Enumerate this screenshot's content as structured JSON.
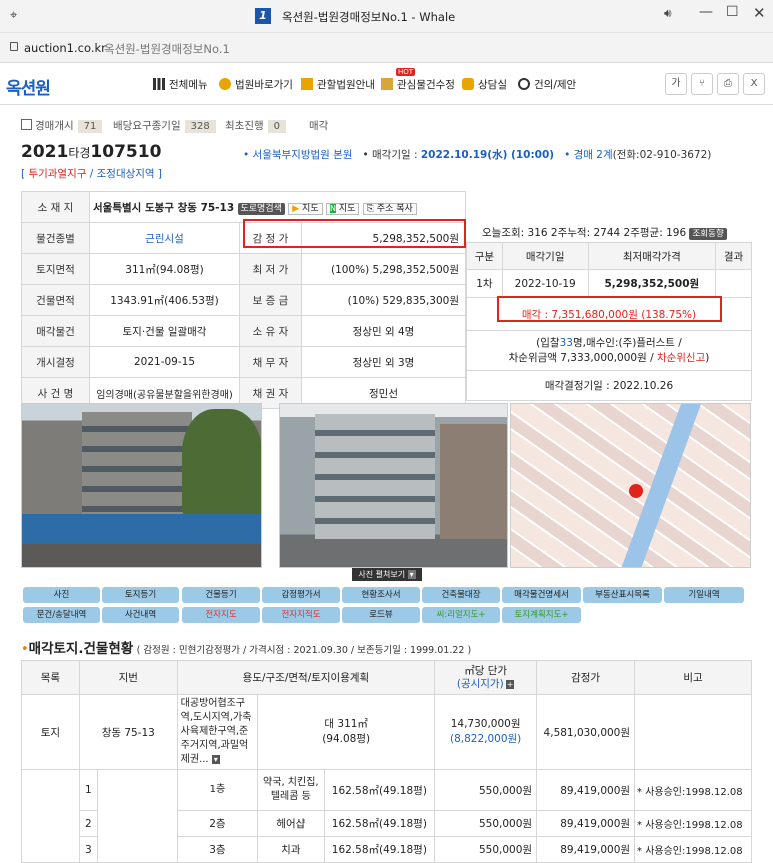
{
  "window": {
    "title": "옥션원-법원경매정보No.1 - Whale"
  },
  "address": {
    "url": "auction1.co.kr",
    "page_title": "옥션원-법원경매정보No.1"
  },
  "nav": {
    "logo": "옥션원",
    "items": [
      "전체메뉴",
      "법원바로가기",
      "관할법원안내",
      "관심물건수정",
      "상담실",
      "건의/제안"
    ],
    "hot_badge": "HOT",
    "right_buttons": [
      "가",
      "share",
      "print",
      "X"
    ]
  },
  "steps": [
    {
      "label": "경매개시",
      "count": "71"
    },
    {
      "label": "배당요구종기일",
      "count": "328"
    },
    {
      "label": "최초진행",
      "count": "0"
    },
    {
      "label": "매각",
      "count": ""
    }
  ],
  "case": {
    "year": "2021",
    "type": "타경",
    "number": "107510",
    "court": "• 서울북부지방법원 본원",
    "sale_label": "• 매각기일 : ",
    "sale_date": "2022.10.19(水) (10:00)",
    "dept_label": "• 경매 ",
    "dept": "2계",
    "phone": "(전화:02-910-3672)",
    "tag_open": "[ ",
    "tag1": "투기과열지구",
    "tag_sep": " / ",
    "tag2": "조정대상지역",
    "tag_close": " ]"
  },
  "info": {
    "addr_label": "소 재 지",
    "addr": "서울특별시 도봉구 창동 75-13",
    "road_btn": "도로명검색",
    "map_btn1": "지도",
    "map_btn2": "지도",
    "copy_btn": "주소 복사",
    "views_label": "오늘조회:",
    "views": "316",
    "views2_label": "2주누적:",
    "views2": "2744",
    "views3_label": "2주평균:",
    "views3": "196",
    "trend_btn": "조회동향",
    "rows": [
      {
        "l1": "물건종별",
        "v1": "근린시설",
        "l2": "감 정 가",
        "v2": "5,298,352,500원"
      },
      {
        "l1": "토지면적",
        "v1": "311㎡(94.08평)",
        "l2": "최 저 가",
        "v2": "(100%) 5,298,352,500원"
      },
      {
        "l1": "건물면적",
        "v1": "1343.91㎡(406.53평)",
        "l2": "보 증 금",
        "v2": "(10%) 529,835,300원"
      },
      {
        "l1": "매각물건",
        "v1": "토지·건물 일괄매각",
        "l2": "소 유 자",
        "v2": "정상민 외 4명"
      },
      {
        "l1": "개시결정",
        "v1": "2021-09-15",
        "l2": "채 무 자",
        "v2": "정상민 외 3명"
      },
      {
        "l1": "사 건 명",
        "v1": "임의경매(공유물분할을위한경매)",
        "l2": "채 권 자",
        "v2": "정민선"
      }
    ]
  },
  "bid": {
    "headers": [
      "구분",
      "매각기일",
      "최저매각가격",
      "결과"
    ],
    "row": {
      "round": "1차",
      "date": "2022-10-19",
      "price": "5,298,352,500원",
      "result": ""
    },
    "sold_label": "매각 : ",
    "sold_price": "7,351,680,000원",
    "sold_pct": "(138.75%)",
    "detail1_pre": "(입찰",
    "detail1_num": "33",
    "detail1_post": "명,매수인:(주)플러스트 /",
    "detail2_pre": "차순위금액 7,333,000,000원 / ",
    "detail2_red": "차순위신고",
    "detail2_post": ")",
    "decision_label": "매각결정기일 : ",
    "decision_date": "2022.10.26"
  },
  "photos": {
    "expand_btn": "사진 펼쳐보기"
  },
  "tabs": [
    {
      "label": "사진",
      "c": ""
    },
    {
      "label": "토지등기",
      "c": ""
    },
    {
      "label": "건물등기",
      "c": ""
    },
    {
      "label": "감정평가서",
      "c": ""
    },
    {
      "label": "현황조사서",
      "c": ""
    },
    {
      "label": "건축물대장",
      "c": ""
    },
    {
      "label": "매각물건명세서",
      "c": ""
    },
    {
      "label": "부동산표시목록",
      "c": ""
    },
    {
      "label": "기일내역",
      "c": ""
    },
    {
      "label": "문건/송달내역",
      "c": ""
    },
    {
      "label": "사건내역",
      "c": ""
    },
    {
      "label": "전자지도",
      "c": "r"
    },
    {
      "label": "전자지적도",
      "c": "r"
    },
    {
      "label": "로드뷰",
      "c": ""
    },
    {
      "label": "씨:리얼지도+",
      "c": "g"
    },
    {
      "label": "토지계획지도+",
      "c": "g"
    }
  ],
  "section": {
    "title": "매각토지.건물현황",
    "appraiser": "( 감정원 : 민현기감정평가 / 가격시점 : 2021.09.30 / 보존등기일 : 1999.01.22 )"
  },
  "land_table": {
    "headers": {
      "col1": "목록",
      "col2": "지번",
      "col3": "용도/구조/면적/토지이용계획",
      "col4a": "㎡당 단가",
      "col4b": "(공시지가)",
      "col5": "감정가",
      "col6": "비고"
    },
    "land": {
      "type": "토지",
      "lot": "창동 75-13",
      "usage": "대공방어협조구역,도시지역,가축사육제한구역,준주거지역,과밀억제권...",
      "area": "대 311㎡",
      "area2": "(94.08평)",
      "unit": "14,730,000원",
      "official": "(8,822,000원)",
      "value": "4,581,030,000원",
      "note": ""
    },
    "rows": [
      {
        "no": "1",
        "floor": "1층",
        "use": "약국, 치킨집, 텔레콤 등",
        "area": "162.58㎡(49.18평)",
        "unit": "550,000원",
        "value": "89,419,000원",
        "note": "* 사용승인:1998.12.08"
      },
      {
        "no": "2",
        "floor": "2층",
        "use": "헤어샵",
        "area": "162.58㎡(49.18평)",
        "unit": "550,000원",
        "value": "89,419,000원",
        "note": "* 사용승인:1998.12.08"
      },
      {
        "no": "3",
        "floor": "3층",
        "use": "치과",
        "area": "162.58㎡(49.18평)",
        "unit": "550,000원",
        "value": "89,419,000원",
        "note": "* 사용승인:1998.12.08"
      }
    ]
  }
}
